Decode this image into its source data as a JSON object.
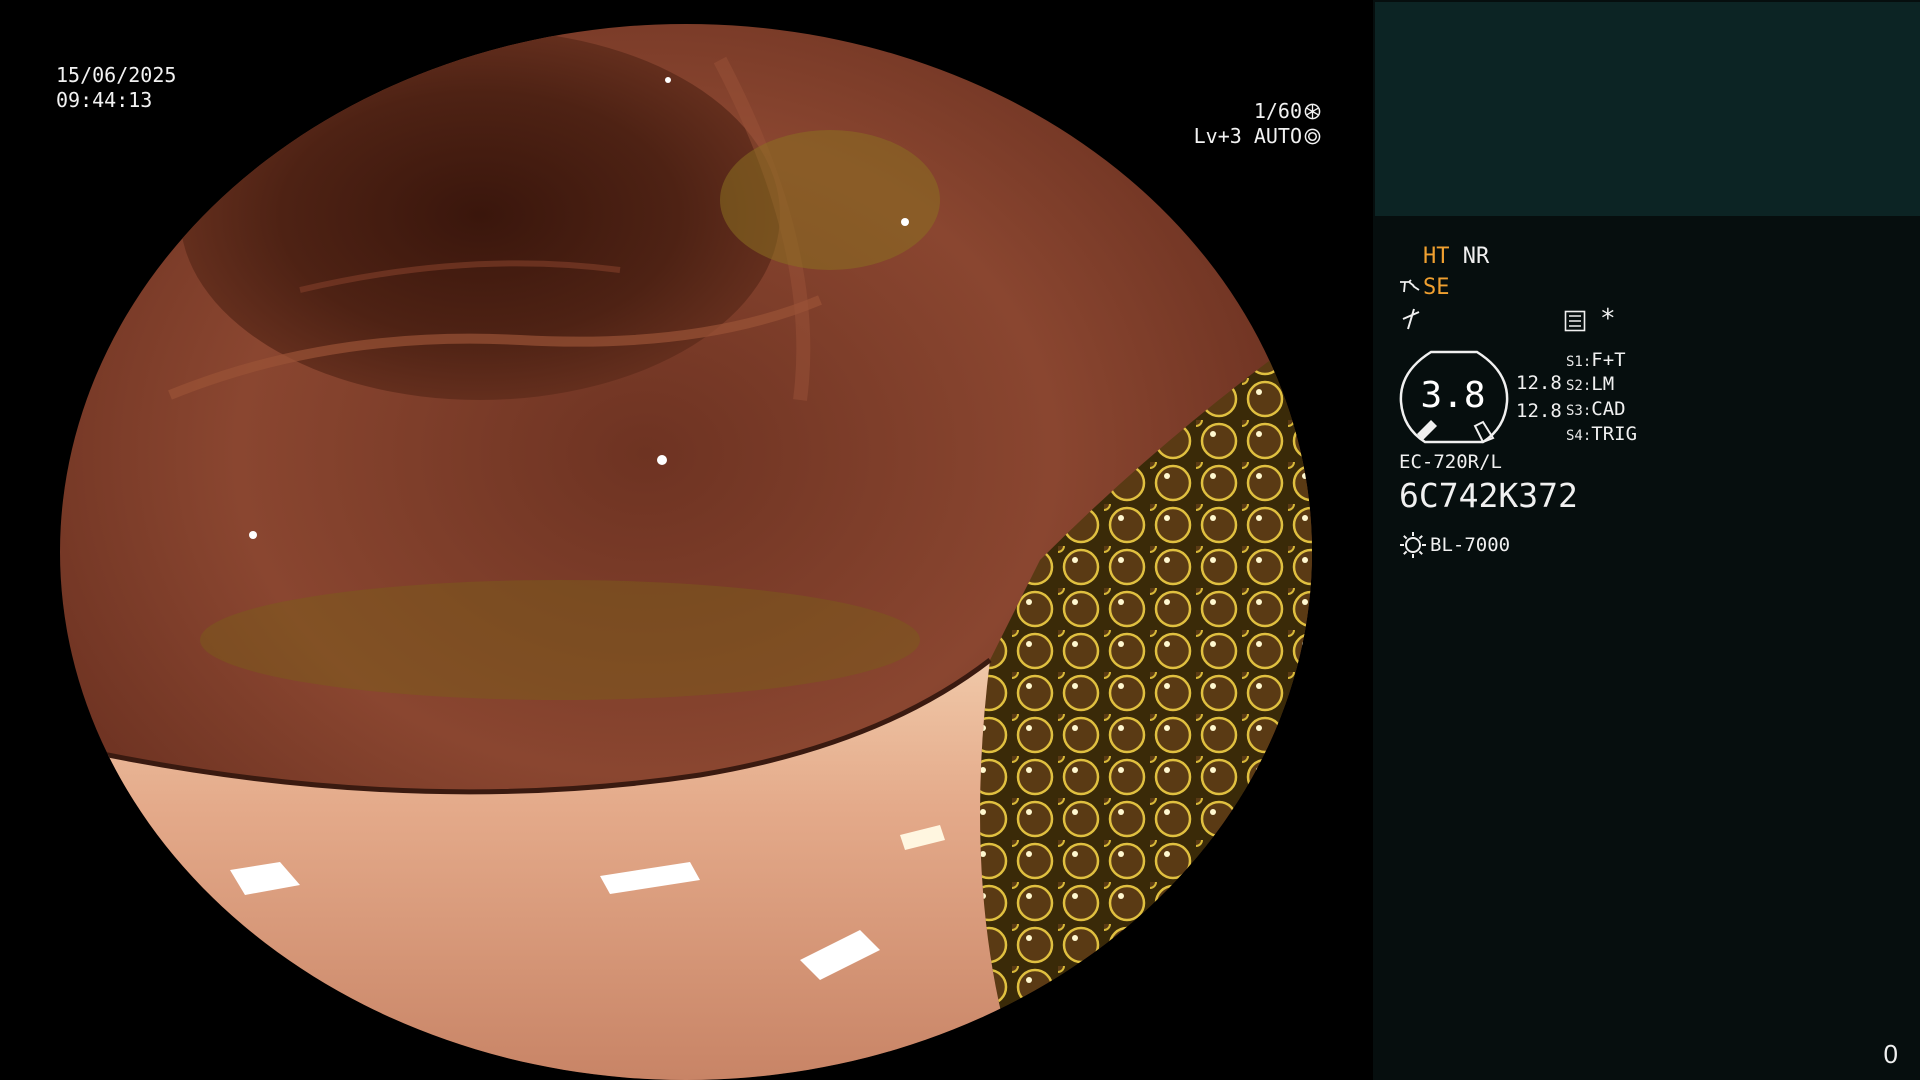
{
  "overlay": {
    "date": "15/06/2025",
    "time": "09:44:13",
    "shutter": "1/60",
    "level": "Lv+3",
    "iris_mode": "AUTO"
  },
  "panel": {
    "enhancement_ht": "HT",
    "enhancement_nr": "NR",
    "structure_enhancement": "SE",
    "asterisk": "*",
    "iris_value": "3.8",
    "values": [
      "12.8",
      "12.8"
    ],
    "switches": [
      {
        "key": "S1:",
        "value": "F+T"
      },
      {
        "key": "S2:",
        "value": "LM"
      },
      {
        "key": "S3:",
        "value": "CAD"
      },
      {
        "key": "S4:",
        "value": "TRIG"
      }
    ],
    "scope_model": "EC-720R/L",
    "serial_number": "6C742K372",
    "light_source": "BL-7000",
    "counter": "0"
  },
  "colors": {
    "accent_orange": "#f0a030",
    "panel_background": "#060e0e",
    "thumbnail_background": "#0c2424"
  },
  "icons": [
    "shutter-icon",
    "auto-iris-icon",
    "scope-tip-icon",
    "flash-icon",
    "preference-icon",
    "light-source-icon"
  ]
}
